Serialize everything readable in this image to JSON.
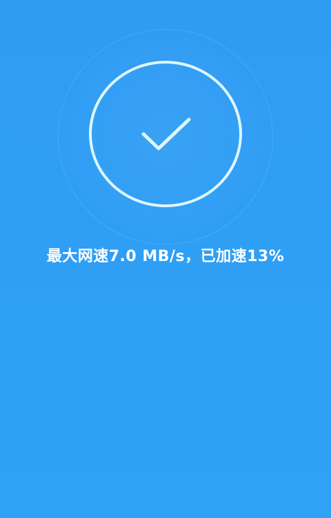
{
  "status": {
    "message": "最大网速7.0 MB/s，已加速13%"
  },
  "icon": {
    "name": "check-icon"
  },
  "colors": {
    "background": "#2f9cf3",
    "ring": "#dff7ff",
    "text": "#ffffff"
  }
}
